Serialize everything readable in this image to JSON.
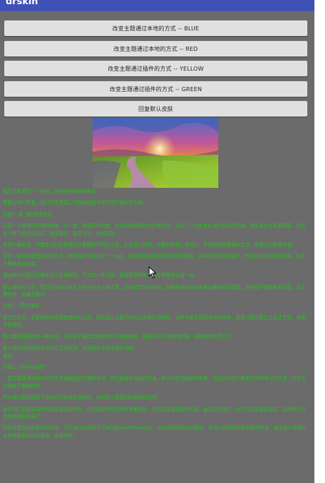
{
  "app": {
    "title": "drskin"
  },
  "buttons": [
    {
      "label": "改变主题通过本地的方式 -- BLUE"
    },
    {
      "label": "改变主题通过本地的方式 -- RED"
    },
    {
      "label": "改变主题通过插件的方式 -- YELLOW"
    },
    {
      "label": "改变主题通过插件的方式 -- GREEN"
    },
    {
      "label": "回复默认皮肤"
    }
  ],
  "hero_image": {
    "icon": "landscape-sunset-image"
  },
  "content": {
    "text_color": "#22c41a",
    "paragraphs": [
      "我们总是想写一个类似，把皮肤的颜色跟着变。",
      "我要让你们看看，我们才算是真正的换肤的技术和实现方案的实现来。",
      "方案一 用 \"换\"皮肤方案",
      "只要一个资源文件里的切换，从一套、再到另外的套，然后动态换肤的方式来实现，大家下一次会变化进行颜色的切换，然后变化之后要跟着，所以这个样子的实现方式，效果很好，这样下去，也很简单。",
      "实现方案的话，只要定义好在资源文件里面的不同的主题，之后通过代码，设置到界面上就可以，不然的话需要重新启动，这种方式效果不错。",
      "另外一种方案就是插件的方式，把资源打包成另外一个apk，通过加载插件的方式来实现换肤，这样的方式效果更好，然后就可以动态的更换，并且不需要重启应用。",
      "用这样的方案的话确实可以实现换肤，不过有一些问题，就是要把所有的控件都重新设置一遍。",
      "那么另外的方案，我们可以通过自定义控件的方式来实现，在创建控件的时候，就根据当前的皮肤来设置相应的属性，这样就不需要重新设置，会方便很多，效果也很好。",
      "方案一 \"原生换肤\"",
      "原生的方式，主要就是利用系统提供的主题，然后通过设置不同的主题来实现换肤，这种方案实现起来比较简单，但是只能在重启之后才生效，效果不是很好。",
      "所以我们需要另外一种方案，可以在不重启应用的情况下完成换肤，而且还可以方便的扩展，这样就比较灵活了。",
      "那么我们就选择插件化的方式来实现，利用插件来完成换肤功能。\n换肤",
      "方案二 \"插件化换肤\"",
      "一是主要是通过插件的方式来加载皮肤包里的资源，然后替换掉当前的资源，就可以实现换肤的效果，而且可以在不重启应用的情况下完成，而且可以动态下载皮肤包。",
      "所以我们最后选择了插件的方式来实现换肤，也就是上面提到的换肤的实现。",
      "首先我们需要获取所有需要换肤的控件，在创建控件的时候就收集起来，然后在需要换肤的时候，遍历这些控件，给它们设置新的属性，这样就可以实现换肤的效果了。",
      "然后就是加载皮肤包的资源，可以通过反射的方式来创建AssetManager，然后添加皮肤包的路径，就可以获取到皮肤包里的资源，最后通过资源的名字来获取对应的资源，完成换肤。"
    ]
  }
}
